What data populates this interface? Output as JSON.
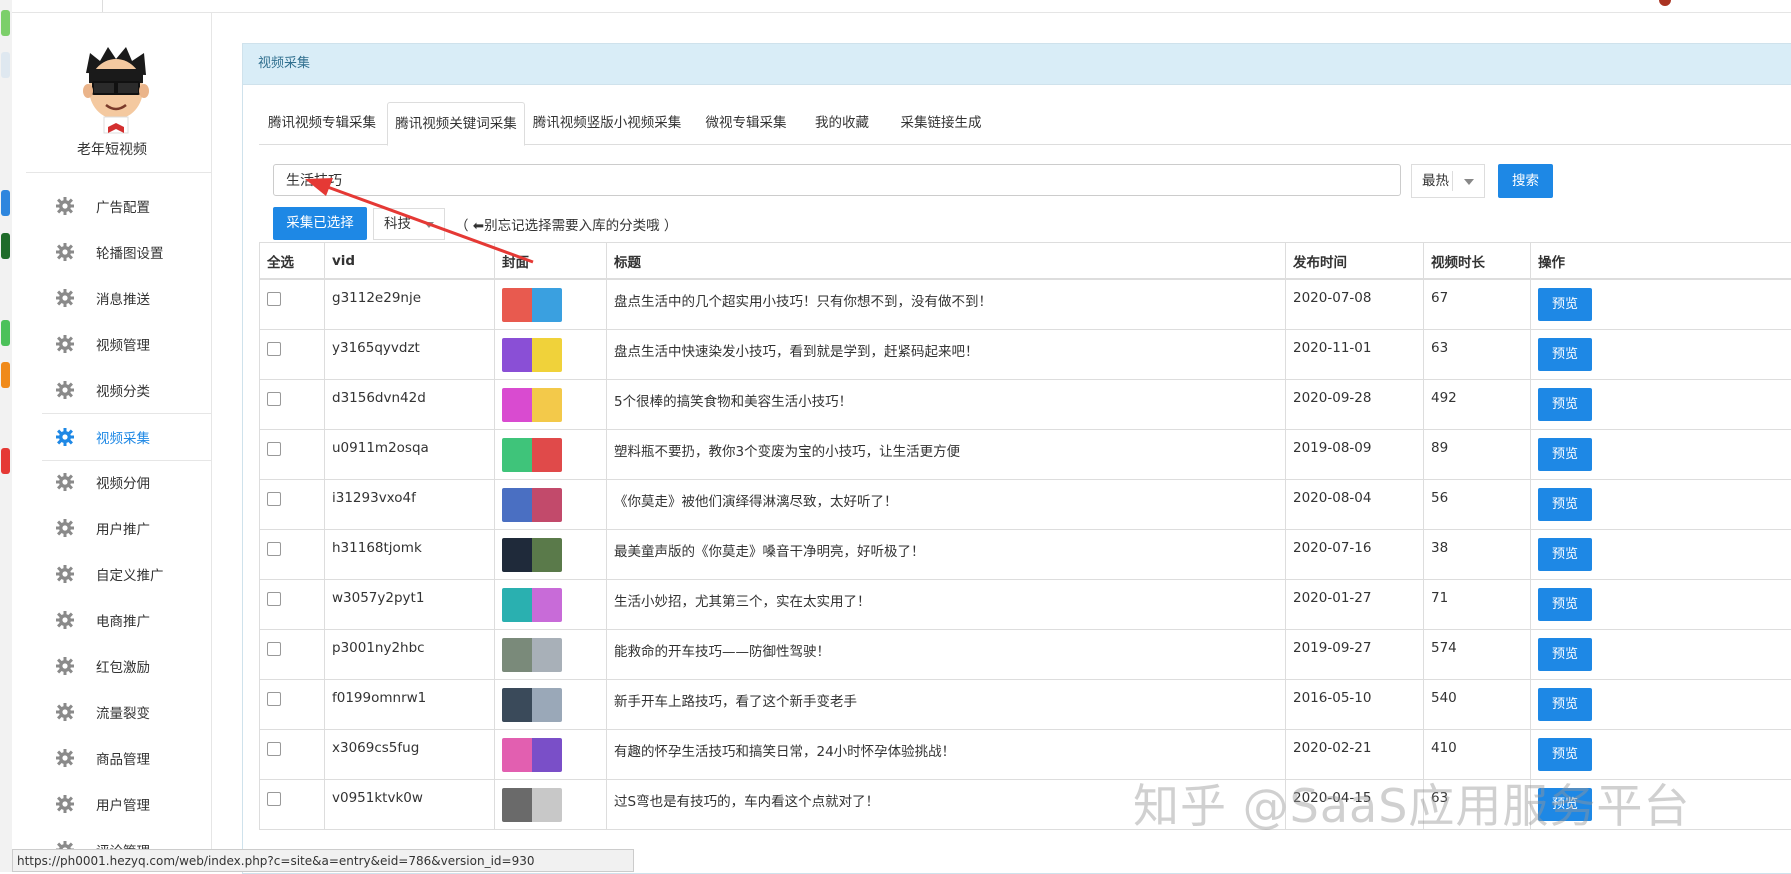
{
  "sidebar": {
    "brand": "老年短视频",
    "items": [
      {
        "label": "广告配置",
        "active": false
      },
      {
        "label": "轮播图设置",
        "active": false
      },
      {
        "label": "消息推送",
        "active": false
      },
      {
        "label": "视频管理",
        "active": false
      },
      {
        "label": "视频分类",
        "active": false
      },
      {
        "label": "视频采集",
        "active": true
      },
      {
        "label": "视频分佣",
        "active": false
      },
      {
        "label": "用户推广",
        "active": false
      },
      {
        "label": "自定义推广",
        "active": false
      },
      {
        "label": "电商推广",
        "active": false
      },
      {
        "label": "红包激励",
        "active": false
      },
      {
        "label": "流量裂变",
        "active": false
      },
      {
        "label": "商品管理",
        "active": false
      },
      {
        "label": "用户管理",
        "active": false
      },
      {
        "label": "评论管理",
        "active": false
      }
    ]
  },
  "panel": {
    "title": "视频采集",
    "tabs": [
      {
        "label": "腾讯视频专辑采集",
        "active": false
      },
      {
        "label": "腾讯视频关键词采集",
        "active": true
      },
      {
        "label": "腾讯视频竖版小视频采集",
        "active": false
      },
      {
        "label": "微视专辑采集",
        "active": false
      },
      {
        "label": "我的收藏",
        "active": false
      },
      {
        "label": "采集链接生成",
        "active": false
      }
    ],
    "search": {
      "value": "生活技巧",
      "sort": "最热",
      "button": "搜索"
    },
    "collect_button": "采集已选择",
    "category": "科技",
    "hint": "（ ⬅别忘记选择需要入库的分类哦 ）"
  },
  "table": {
    "headers": {
      "select": "全选",
      "vid": "vid",
      "cover": "封面",
      "title": "标题",
      "date": "发布时间",
      "duration": "视频时长",
      "action": "操作"
    },
    "preview_label": "预览",
    "rows": [
      {
        "vid": "g3112e29nje",
        "title": "盘点生活中的几个超实用小技巧！只有你想不到，没有做不到！",
        "date": "2020-07-08",
        "duration": "67",
        "thumb": [
          "#e85a4f",
          "#3aa0e0"
        ]
      },
      {
        "vid": "y3165qyvdzt",
        "title": "盘点生活中快速染发小技巧，看到就是学到，赶紧码起来吧！",
        "date": "2020-11-01",
        "duration": "63",
        "thumb": [
          "#8a4fd6",
          "#f0d23a"
        ]
      },
      {
        "vid": "d3156dvn42d",
        "title": "5个很棒的搞笑食物和美容生活小技巧！",
        "date": "2020-09-28",
        "duration": "492",
        "thumb": [
          "#d94bd0",
          "#f3c94a"
        ]
      },
      {
        "vid": "u0911m2osqa",
        "title": "塑料瓶不要扔，教你3个变废为宝的小技巧，让生活更方便",
        "date": "2019-08-09",
        "duration": "89",
        "thumb": [
          "#3fc47a",
          "#e04a4a"
        ]
      },
      {
        "vid": "i31293vxo4f",
        "title": "《你莫走》被他们演绎得淋漓尽致，太好听了！",
        "date": "2020-08-04",
        "duration": "56",
        "thumb": [
          "#4a6fc2",
          "#c24a6b"
        ]
      },
      {
        "vid": "h31168tjomk",
        "title": "最美童声版的《你莫走》嗓音干净明亮，好听极了！",
        "date": "2020-07-16",
        "duration": "38",
        "thumb": [
          "#1f2a3a",
          "#5a7a4a"
        ]
      },
      {
        "vid": "w3057y2pyt1",
        "title": "生活小妙招，尤其第三个，实在太实用了！",
        "date": "2020-01-27",
        "duration": "71",
        "thumb": [
          "#2ab0b0",
          "#c86bd8"
        ]
      },
      {
        "vid": "p3001ny2hbc",
        "title": "能救命的开车技巧——防御性驾驶！",
        "date": "2019-09-27",
        "duration": "574",
        "thumb": [
          "#7a8a7a",
          "#a8b0b8"
        ]
      },
      {
        "vid": "f0199omnrw1",
        "title": "新手开车上路技巧，看了这个新手变老手",
        "date": "2016-05-10",
        "duration": "540",
        "thumb": [
          "#3a4a5a",
          "#9aa8b8"
        ]
      },
      {
        "vid": "x3069cs5fug",
        "title": "有趣的怀孕生活技巧和搞笑日常，24小时怀孕体验挑战！",
        "date": "2020-02-21",
        "duration": "410",
        "thumb": [
          "#e25fb0",
          "#7a4fc8"
        ]
      },
      {
        "vid": "v0951ktvk0w",
        "title": "过S弯也是有技巧的，车内看这个点就对了！",
        "date": "2020-04-15",
        "duration": "63",
        "thumb": [
          "#6a6a6a",
          "#c8c8c8"
        ]
      }
    ]
  },
  "watermark": "知乎 @SaaS应用服务平台",
  "status_url": "https://ph0001.hezyq.com/web/index.php?c=site&a=entry&eid=786&version_id=930",
  "colors": {
    "accent": "#1e88e5",
    "panel_header": "#d9edf7",
    "arrow": "#e53935"
  }
}
